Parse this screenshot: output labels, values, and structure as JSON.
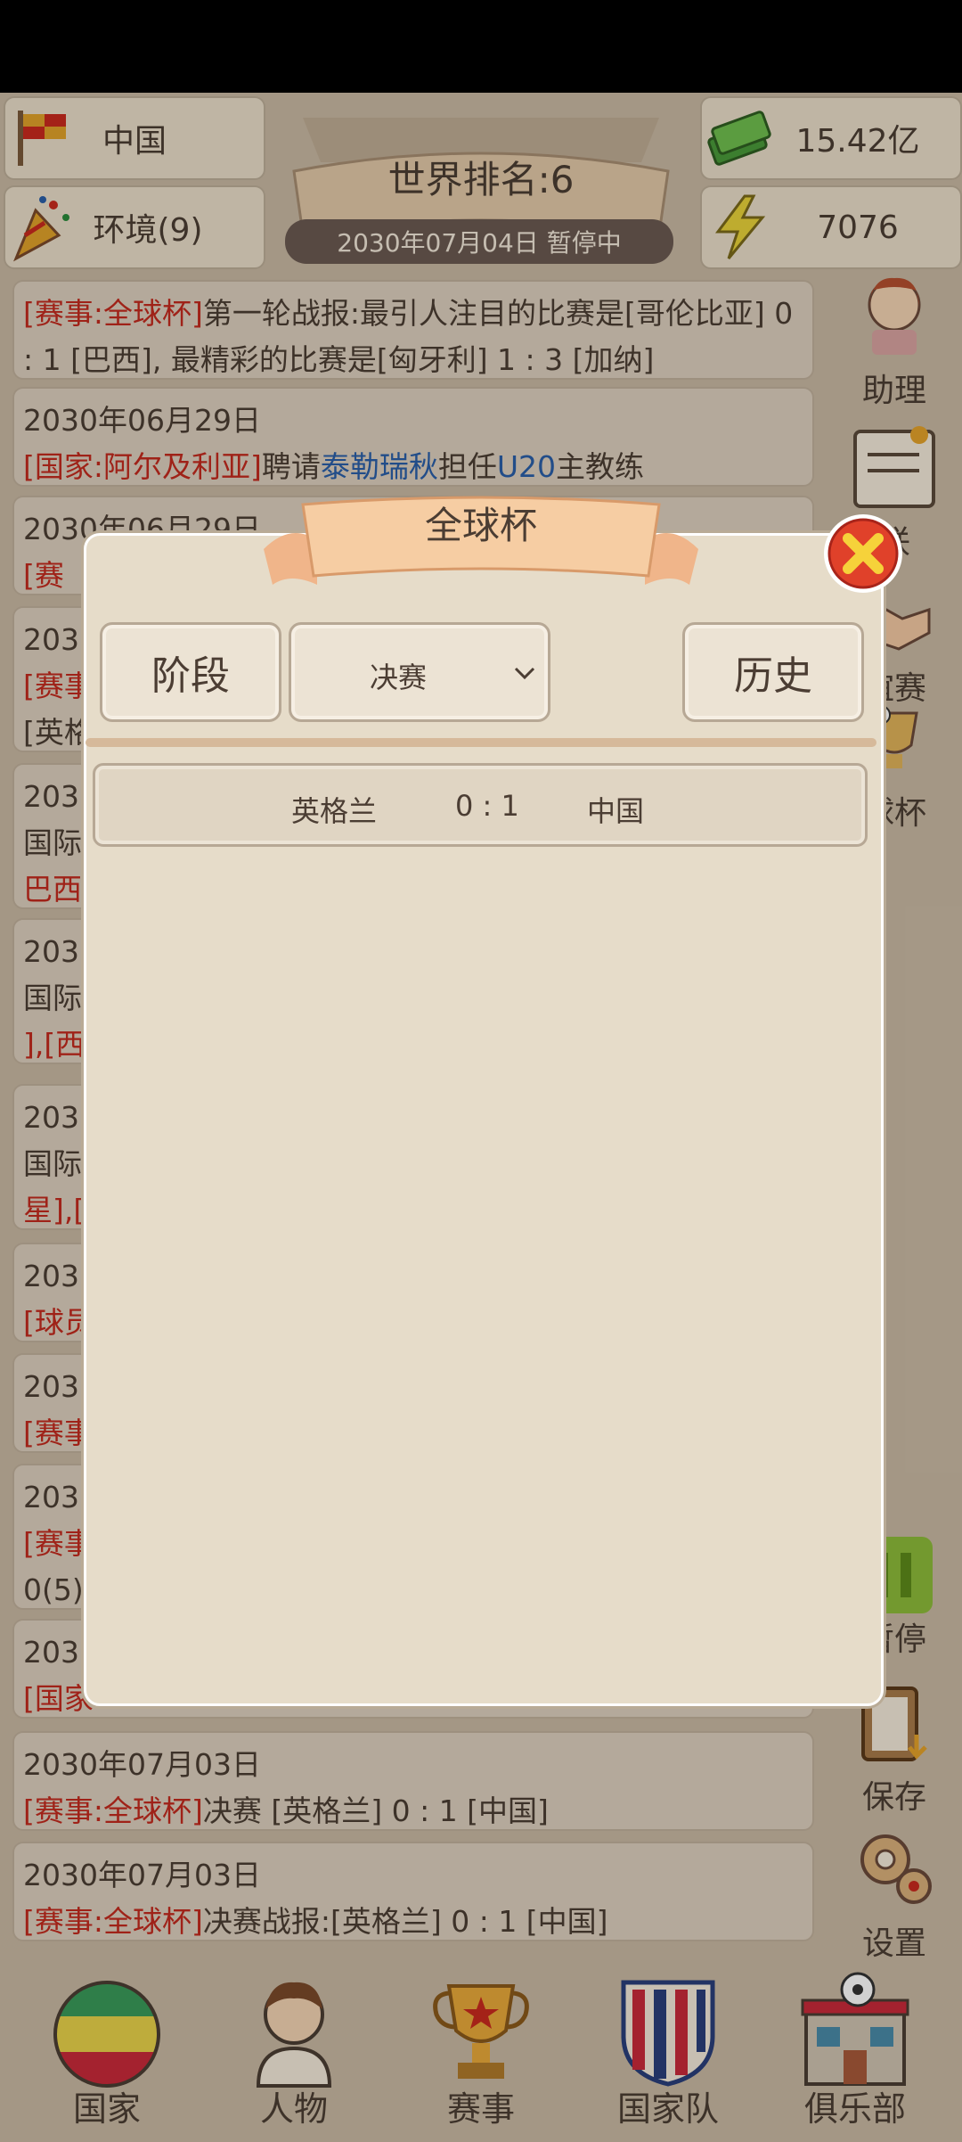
{
  "status_bar": {},
  "top": {
    "country": "中国",
    "environment": "环境(9)",
    "world_rank": "世界排名:6",
    "date_status": "2030年07月04日 暂停中",
    "money": "15.42亿",
    "energy": "7076"
  },
  "news": [
    {
      "tag": "[赛事:全球杯]",
      "text": "第一轮战报:最引人注目的比赛是[哥伦比亚] 0 : 1 [巴西], 最精彩的比赛是[匈牙利] 1 : 3 [加纳]"
    },
    {
      "date": "2030年06月29日",
      "tag": "[国家:阿尔及利亚]",
      "text_a": "聘请",
      "person": "泰勒瑞秋",
      "text_b": "担任",
      "team": "U20",
      "text_c": "主教练"
    },
    {
      "date": "2030年06月29日",
      "tag": "[赛"
    },
    {
      "date": "2030",
      "tag": "[赛事",
      "text": "[英格"
    },
    {
      "date": "2030",
      "text": "国际",
      "tag": "巴西"
    },
    {
      "date": "2030",
      "text": "国际",
      "tag": "],[西"
    },
    {
      "date": "2030",
      "text": "国际",
      "tag": "星],["
    },
    {
      "date": "2030",
      "tag": "[球员"
    },
    {
      "date": "2030",
      "tag": "[赛事"
    },
    {
      "date": "2030",
      "tag": "[赛事",
      "text": "0(5)"
    },
    {
      "date": "2030",
      "tag": "[国家"
    },
    {
      "date": "2030年07月03日",
      "tag": "[赛事:全球杯]",
      "text": "决赛 [英格兰] 0 : 1 [中国]"
    },
    {
      "date": "2030年07月03日",
      "tag": "[赛事:全球杯]",
      "text": "决赛战报:[英格兰] 0 : 1 [中国]"
    }
  ],
  "side_menu": {
    "assistant": "助理",
    "league": "联",
    "friendly": "谊赛",
    "cup": "球杯",
    "pause": "暂停",
    "save": "保存",
    "settings": "设置"
  },
  "nav": {
    "country": "国家",
    "people": "人物",
    "events": "赛事",
    "national_team": "国家队",
    "club": "俱乐部"
  },
  "modal": {
    "title": "全球杯",
    "stage_label": "阶段",
    "stage_value": "决赛",
    "history_label": "历史",
    "match": {
      "home": "英格兰",
      "score": "0 : 1",
      "away": "中国"
    }
  },
  "colors": {
    "accent_red": "#c22a1e",
    "link_blue": "#2a5fa8",
    "panel": "#e6dcc9"
  }
}
